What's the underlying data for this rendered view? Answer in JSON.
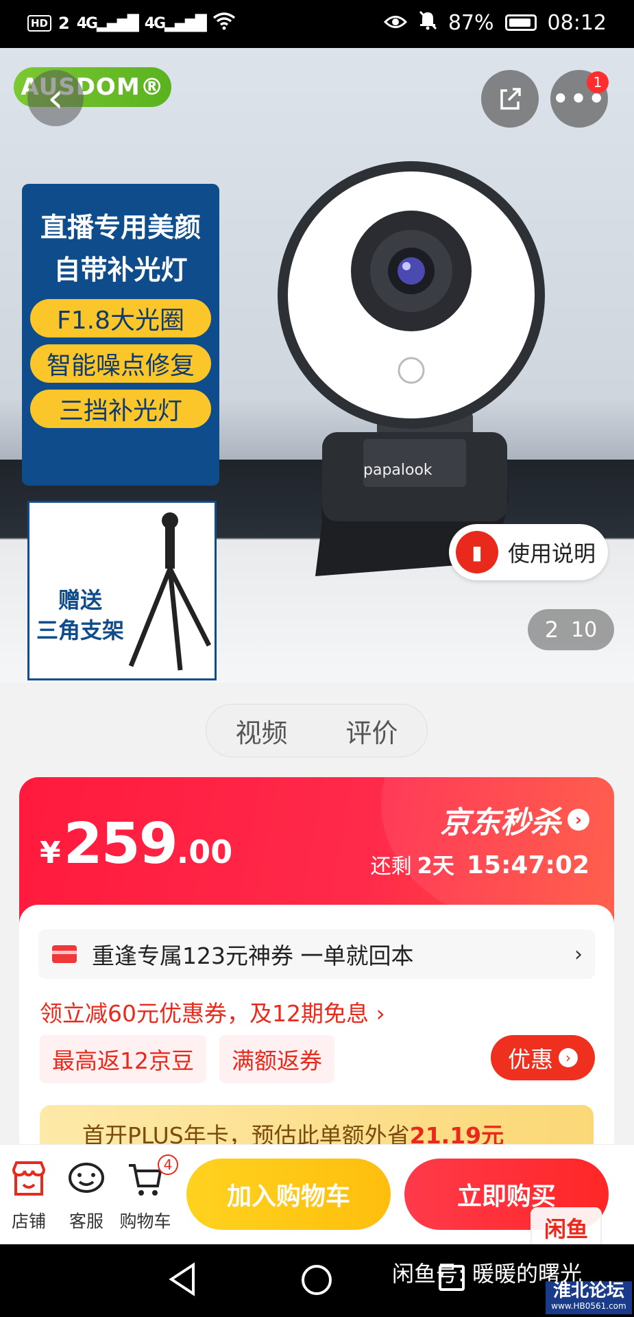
{
  "status_bar": {
    "hd": "HD",
    "sim": "2",
    "net1": "4G",
    "net2": "4G",
    "battery": "87%",
    "time": "08:12"
  },
  "hero": {
    "brand_logo": "AUSDOM®",
    "notification_count": "1",
    "promo_title_1": "直播专用美颜",
    "promo_title_2": "自带补光灯",
    "promo_pills": [
      "F1.8大光圈",
      "智能噪点修复",
      "三挡补光灯"
    ],
    "tripod_text_1": "赠送",
    "tripod_text_2": "三角支架",
    "camera_brand": "papalook",
    "manual_label": "使用说明",
    "page_current": "2",
    "page_total": "10"
  },
  "media_tabs": [
    "视频",
    "评价"
  ],
  "price_card": {
    "currency": "¥",
    "price_int": "259",
    "price_dec": ".00",
    "seckill_label": "京东秒杀",
    "remaining_prefix": "还剩",
    "remaining_days": "2天",
    "countdown": "15:47:02",
    "coupon_text": "重逢专属123元神券 一单就回本",
    "discount_line": "领立减60元优惠券，及12期免息 ›",
    "tags": [
      "最高返12京豆",
      "满额返券"
    ],
    "youhui_label": "优惠",
    "plus_text_prefix": "首开PLUS年卡，预估此单额外省",
    "plus_amount": "21.19元"
  },
  "action_bar": {
    "shop_label": "店铺",
    "service_label": "客服",
    "cart_label": "购物车",
    "cart_count": "4",
    "add_to_cart": "加入购物车",
    "buy_now": "立即购买",
    "xianyu_stamp": "闲鱼"
  },
  "overlay": {
    "watermark": "闲鱼号:  暖暖的曙光",
    "forum_name": "淮北论坛",
    "forum_url": "www.HB0561.com"
  }
}
